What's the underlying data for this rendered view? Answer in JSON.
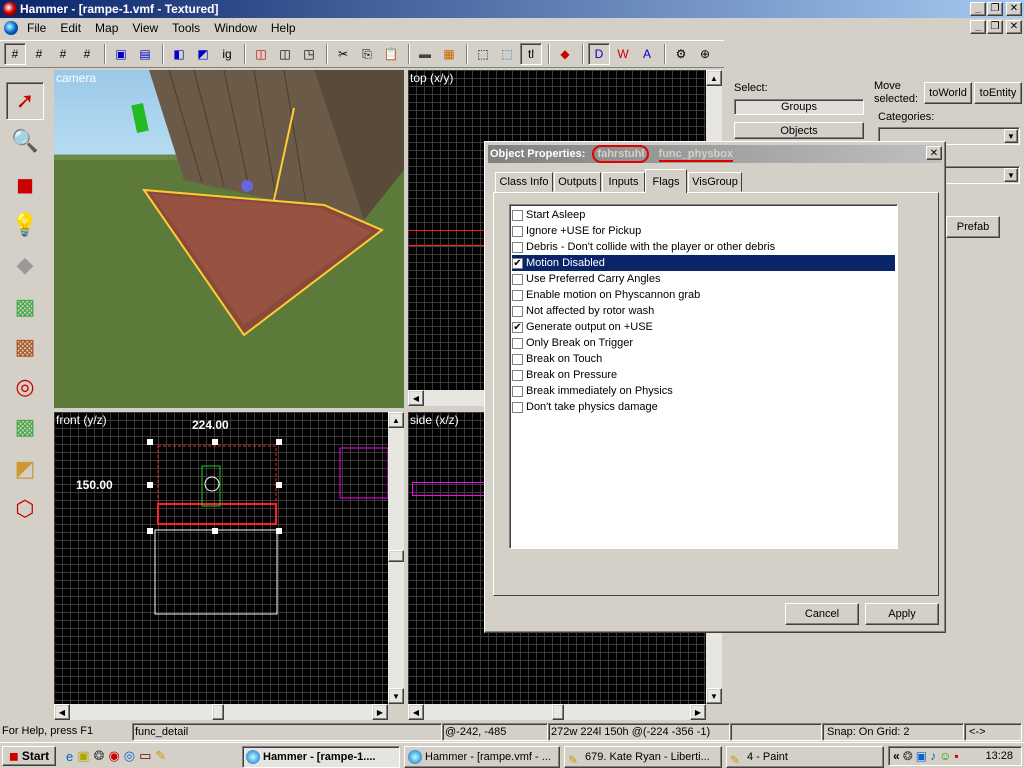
{
  "window": {
    "title": "Hammer - [rampe-1.vmf - Textured]",
    "minimize": "_",
    "restore": "❐",
    "close": "✕"
  },
  "menu": [
    "File",
    "Edit",
    "Map",
    "View",
    "Tools",
    "Window",
    "Help"
  ],
  "viewports": {
    "camera": "camera",
    "top": "top (x/y)",
    "front": "front (y/z)",
    "side": "side (x/z)",
    "front_width": "224.00",
    "front_height": "150.00"
  },
  "right_panel": {
    "select_label": "Select:",
    "groups": "Groups",
    "objects": "Objects",
    "move_selected": "Move selected:",
    "to_world": "toWorld",
    "to_entity": "toEntity",
    "categories": "Categories:",
    "prefab": "Prefab"
  },
  "dialog": {
    "title_prefix": "Object Properties:",
    "entity_name": "fahrstuhl",
    "entity_class": "func_physbox",
    "close": "✕",
    "tabs": [
      "Class Info",
      "Outputs",
      "Inputs",
      "Flags",
      "VisGroup"
    ],
    "active_tab": "Flags",
    "flags": [
      {
        "label": "Start Asleep",
        "checked": false,
        "selected": false
      },
      {
        "label": "Ignore +USE for Pickup",
        "checked": false,
        "selected": false
      },
      {
        "label": "Debris - Don't collide with the player or other debris",
        "checked": false,
        "selected": false
      },
      {
        "label": "Motion Disabled",
        "checked": true,
        "selected": true
      },
      {
        "label": "Use Preferred Carry Angles",
        "checked": false,
        "selected": false
      },
      {
        "label": "Enable motion on Physcannon grab",
        "checked": false,
        "selected": false
      },
      {
        "label": "Not affected by rotor wash",
        "checked": false,
        "selected": false
      },
      {
        "label": "Generate output on +USE",
        "checked": true,
        "selected": false
      },
      {
        "label": "Only Break on Trigger",
        "checked": false,
        "selected": false
      },
      {
        "label": "Break on Touch",
        "checked": false,
        "selected": false
      },
      {
        "label": "Break on Pressure",
        "checked": false,
        "selected": false
      },
      {
        "label": "Break immediately on Physics",
        "checked": false,
        "selected": false
      },
      {
        "label": "Don't take physics damage",
        "checked": false,
        "selected": false
      }
    ],
    "cancel": "Cancel",
    "apply": "Apply"
  },
  "status": {
    "help": "For Help, press F1",
    "object": "func_detail",
    "cursor": "@-242, -485",
    "size": "272w 224l 150h @(-224 -356 -1)",
    "snap": "Snap: On Grid: 2",
    "nav": "<->"
  },
  "taskbar": {
    "start": "Start",
    "tasks": [
      "Hammer - [rampe-1....",
      "Hammer - [rampe.vmf - ...",
      "679. Kate Ryan - Liberti...",
      "4 - Paint"
    ],
    "clock": "13:28",
    "tray_expand": "«"
  },
  "colors": {
    "title_active": "#0a246a",
    "selection": "#0a246a",
    "annotation": "#e00000",
    "brush_selected": "#ff2020",
    "entity": "#ff00ff"
  }
}
